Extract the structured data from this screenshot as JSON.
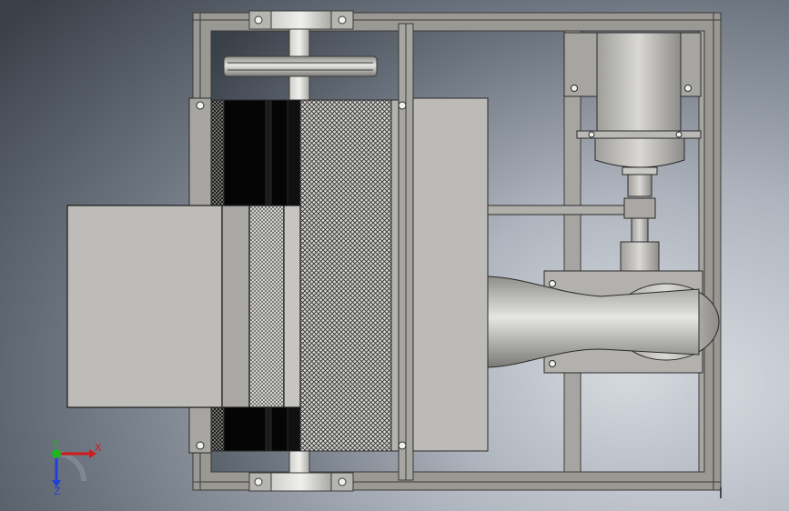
{
  "viewport": {
    "background_colors": [
      "#3a4048",
      "#6b737e",
      "#aeb4bd",
      "#d8dce2"
    ]
  },
  "model": {
    "frame_color": "#9a9893",
    "part_color": "#b9b8b4",
    "dark_color": "#050505",
    "mesh_color": "#2a2a2a"
  },
  "triad": {
    "x_label": "X",
    "y_label": "Y",
    "z_label": "Z",
    "x_color": "#d11a1a",
    "y_color": "#1fb51f",
    "z_color": "#2140d8"
  }
}
